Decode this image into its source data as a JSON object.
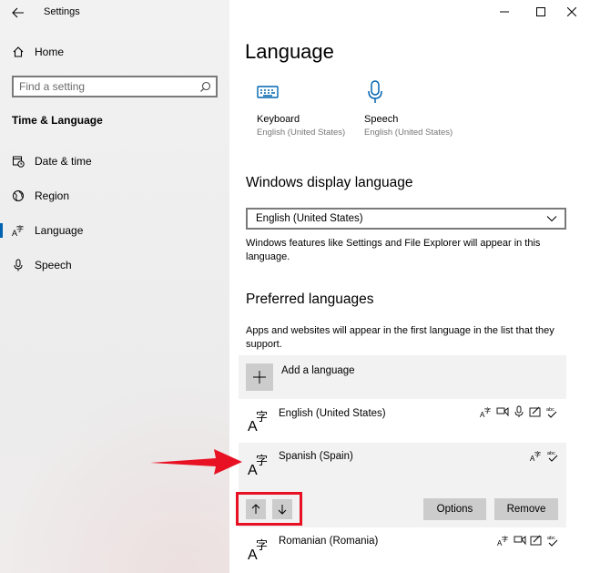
{
  "window": {
    "title": "Settings",
    "controls": {
      "minimize": "minimize-icon",
      "maximize": "maximize-icon",
      "close": "close-icon"
    }
  },
  "sidebar": {
    "home_label": "Home",
    "search": {
      "placeholder": "Find a setting",
      "value": ""
    },
    "section_title": "Time & Language",
    "items": [
      {
        "label": "Date & time",
        "icon": "calendar-clock-icon"
      },
      {
        "label": "Region",
        "icon": "globe-icon"
      },
      {
        "label": "Language",
        "icon": "language-icon",
        "active": true
      },
      {
        "label": "Speech",
        "icon": "microphone-icon"
      }
    ]
  },
  "main": {
    "title": "Language",
    "tiles": [
      {
        "label": "Keyboard",
        "sub": "English (United States)",
        "icon": "keyboard-icon"
      },
      {
        "label": "Speech",
        "sub": "English (United States)",
        "icon": "microphone-icon"
      }
    ],
    "display_language": {
      "heading": "Windows display language",
      "selected": "English (United States)",
      "description": "Windows features like Settings and File Explorer will appear in this language."
    },
    "preferred": {
      "heading": "Preferred languages",
      "description": "Apps and websites will appear in the first language in the list that they support.",
      "add_label": "Add a language",
      "languages": [
        {
          "name": "English (United States)",
          "features": [
            "display-language-icon",
            "text-to-speech-icon",
            "speech-recognition-icon",
            "handwriting-icon",
            "spellcheck-icon"
          ]
        },
        {
          "name": "Spanish (Spain)",
          "features": [
            "display-language-icon",
            "spellcheck-icon"
          ],
          "selected": true
        },
        {
          "name": "Romanian (Romania)",
          "features": [
            "display-language-icon",
            "text-to-speech-icon",
            "handwriting-icon",
            "spellcheck-icon"
          ]
        }
      ],
      "options_label": "Options",
      "remove_label": "Remove"
    }
  },
  "colors": {
    "accent": "#0063b1",
    "highlight": "#e81123",
    "button": "#cccccc"
  }
}
